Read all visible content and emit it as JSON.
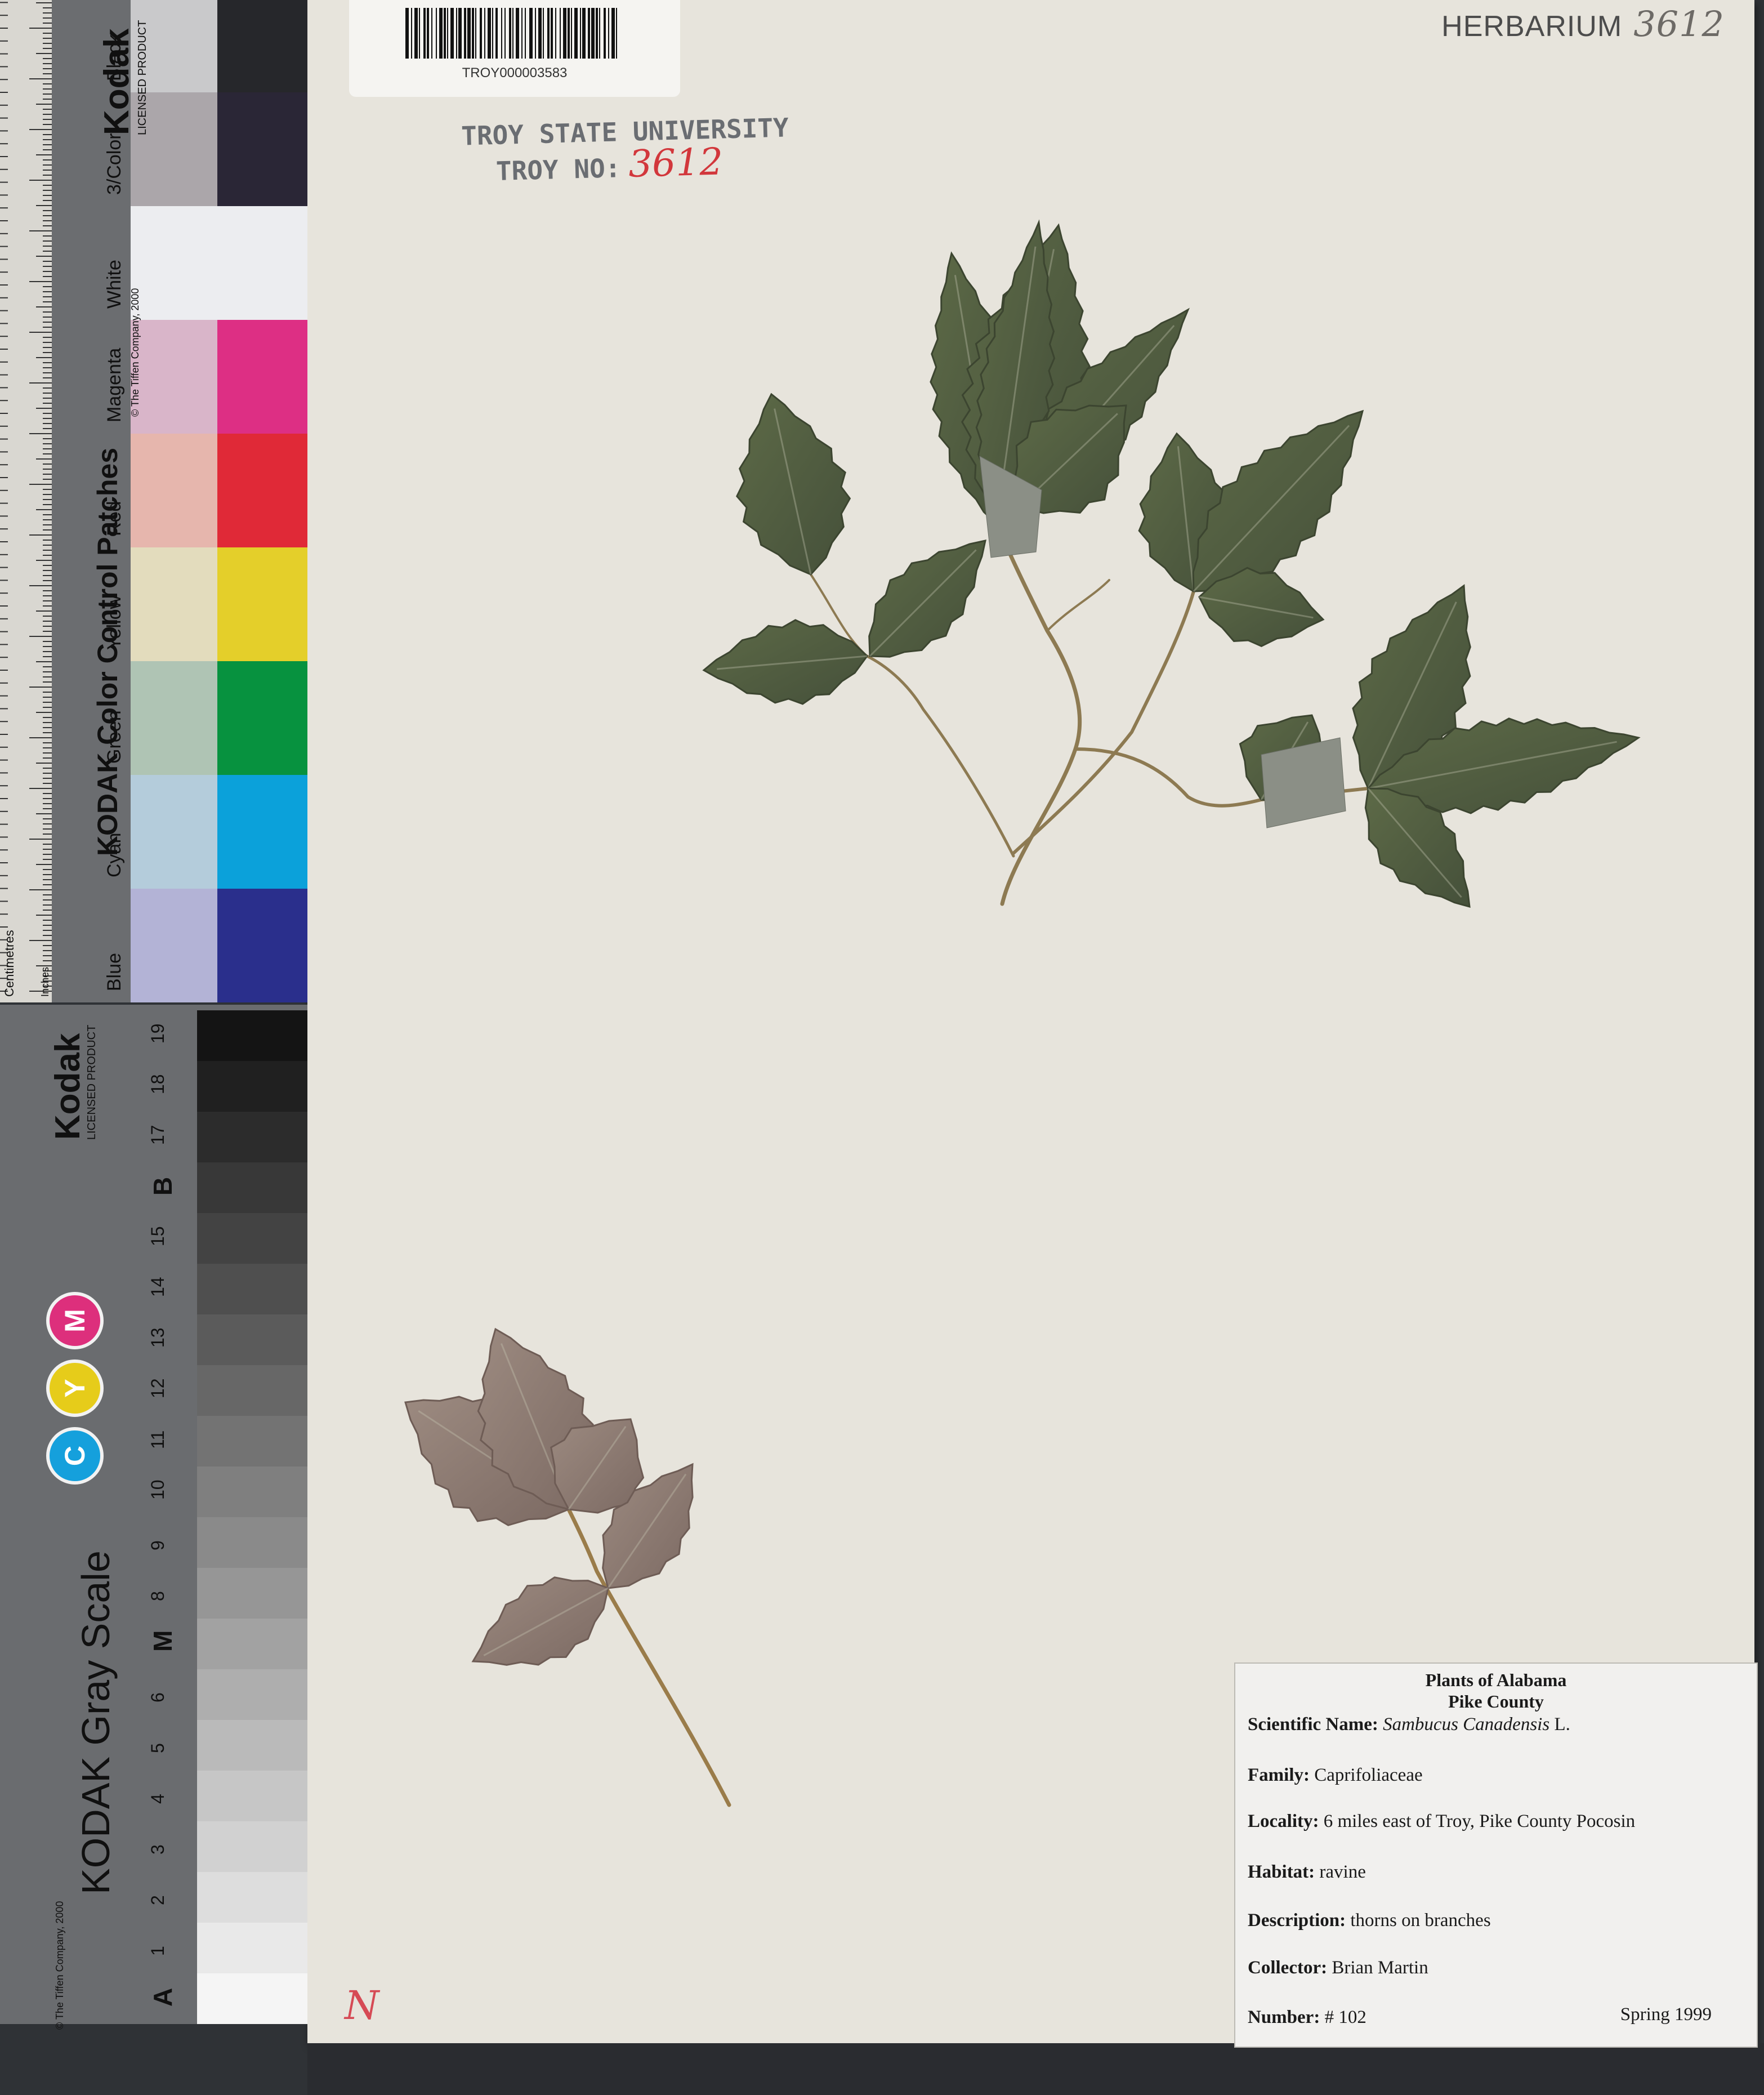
{
  "color_card": {
    "brand": "Kodak",
    "licensed": "LICENSED PRODUCT",
    "title": "KODAK Color Control Patches",
    "copyright": "© The Tiffen Company, 2000",
    "patch_labels": [
      "Blue",
      "Cyan",
      "Green",
      "Yellow",
      "Red",
      "Magenta",
      "White",
      "3/Color",
      "Black"
    ],
    "patch_colors": {
      "Blue": [
        "#b3b3d6",
        "#2a2f8c"
      ],
      "Cyan": [
        "#b4ccdb",
        "#0ba1da"
      ],
      "Green": [
        "#afc4b4",
        "#07923f"
      ],
      "Yellow": [
        "#e3dcbd",
        "#e4cf2a"
      ],
      "Red": [
        "#e6b6ad",
        "#e02937"
      ],
      "Magenta": [
        "#d9b5c9",
        "#dd2f84"
      ],
      "White": [
        "#ecedf0",
        "#ecedf0"
      ],
      "3/Color": [
        "#aba6aa",
        "#2a2636"
      ],
      "Black": [
        "#c9c9cb",
        "#26272b"
      ]
    },
    "ruler_units_cm": "Centimetres",
    "ruler_units_in": "Inches"
  },
  "gray_card": {
    "brand": "Kodak",
    "licensed": "LICENSED PRODUCT",
    "title": "KODAK Gray Scale",
    "copyright": "© The Tiffen Company, 2000",
    "cmy": [
      "C",
      "Y",
      "M"
    ],
    "steps": [
      "A",
      "1",
      "2",
      "3",
      "4",
      "5",
      "6",
      "M",
      "8",
      "9",
      "10",
      "11",
      "12",
      "13",
      "14",
      "15",
      "B",
      "17",
      "18",
      "19"
    ]
  },
  "barcode": {
    "code": "TROY000003583"
  },
  "herbarium_header": {
    "text": "HERBARIUM",
    "handwritten_number": "3612"
  },
  "stamp": {
    "line1": "TROY STATE UNIVERSITY",
    "line2": "TROY NO:",
    "number": "3612"
  },
  "margin_mark": "N",
  "label": {
    "title_line1": "Plants of Alabama",
    "title_line2": "Pike County",
    "scientific_name_label": "Scientific Name:",
    "scientific_name": "Sambucus Canadensis",
    "author": "L.",
    "family_label": "Family:",
    "family": "Caprifoliaceae",
    "locality_label": "Locality:",
    "locality": "6 miles east of Troy, Pike County Pocosin",
    "habitat_label": "Habitat:",
    "habitat": "ravine",
    "description_label": "Description:",
    "description": "thorns on branches",
    "collector_label": "Collector:",
    "collector": "Brian Martin",
    "number_label": "Number:",
    "number": "# 102",
    "date": "Spring 1999"
  }
}
